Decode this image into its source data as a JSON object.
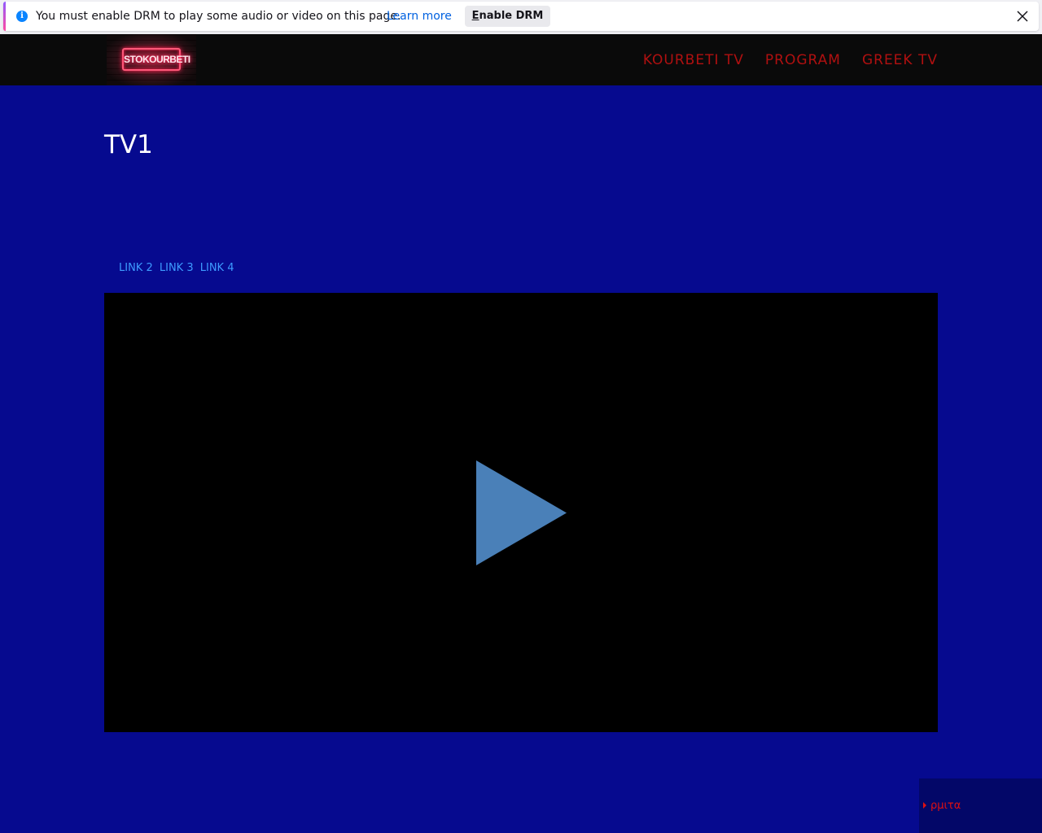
{
  "notification": {
    "message": "You must enable DRM to play some audio or video on this page.",
    "learn_more": "Learn more",
    "button_first_letter": "E",
    "button_rest": "nable DRM"
  },
  "header": {
    "logo_text": "STOKOURBETI",
    "nav": [
      {
        "label": "KOURBETI TV"
      },
      {
        "label": "PROGRAM"
      },
      {
        "label": "GREEK TV"
      }
    ]
  },
  "main": {
    "title": "TV1",
    "links": [
      {
        "label": "LINK 2"
      },
      {
        "label": "LINK 3"
      },
      {
        "label": "LINK 4"
      }
    ]
  },
  "corner_widget": {
    "text": "ρμιτα"
  },
  "colors": {
    "page_background": "#060a8f",
    "header_background": "#0a0a0a",
    "nav_text": "#b01010",
    "link_text": "#3d9bff",
    "play_button": "#4a80b8"
  }
}
